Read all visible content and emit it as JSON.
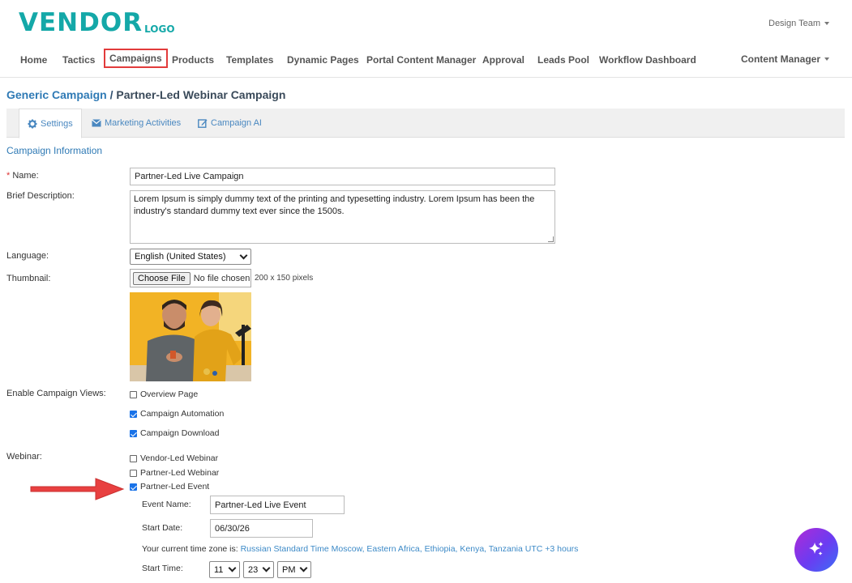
{
  "brand": {
    "name": "VENDOR",
    "sub": "LOGO",
    "color": "#14a8a8"
  },
  "user_menu": {
    "label": "Design Team"
  },
  "nav": {
    "items": [
      "Home",
      "Tactics",
      "Campaigns",
      "Products",
      "Templates",
      "Dynamic Pages",
      "Portal Content Manager",
      "Approval",
      "Leads Pool",
      "Workflow Dashboard"
    ],
    "highlighted": "Campaigns",
    "right": "Content Manager"
  },
  "breadcrumb": {
    "parent": "Generic Campaign",
    "separator": " / ",
    "current": "Partner-Led Webinar Campaign"
  },
  "tabs": [
    {
      "label": "Settings",
      "icon": "gear-icon",
      "active": true
    },
    {
      "label": "Marketing Activities",
      "icon": "envelope-icon",
      "active": false
    },
    {
      "label": "Campaign AI",
      "icon": "edit-icon",
      "active": false
    }
  ],
  "section_title": "Campaign Information",
  "form": {
    "name_required_mark": "*",
    "name_label": " Name:",
    "name_value": "Partner-Led Live Campaign",
    "description_label": "Brief Description:",
    "description_value": "Lorem Ipsum is simply dummy text of the printing and typesetting industry. Lorem Ipsum has been the industry's standard dummy text ever since the 1500s.",
    "language_label": "Language:",
    "language_value": "English (United States)",
    "thumbnail_label": "Thumbnail:",
    "file_button": "Choose File",
    "file_status": "No file chosen",
    "thumbnail_hint": "200 x 150 pixels",
    "views_label": "Enable Campaign Views:",
    "views": [
      {
        "label": "Overview Page",
        "checked": false
      },
      {
        "label": "Campaign Automation",
        "checked": true
      },
      {
        "label": "Campaign Download",
        "checked": true
      }
    ],
    "webinar_label": "Webinar:",
    "webinar_options": [
      {
        "label": "Vendor-Led Webinar",
        "checked": false
      },
      {
        "label": "Partner-Led Webinar",
        "checked": false
      },
      {
        "label": "Partner-Led Event",
        "checked": true
      }
    ],
    "event_name_label": "Event Name:",
    "event_name_value": "Partner-Led Live Event",
    "start_date_label": "Start Date:",
    "start_date_value": "06/30/26",
    "timezone_prefix": "Your current time zone is: ",
    "timezone_value": "Russian Standard Time Moscow, Eastern Africa, Ethiopia, Kenya, Tanzania UTC +3 hours",
    "start_time_label": "Start Time:",
    "start_hour": "11",
    "start_minute": "23",
    "start_ampm": "PM"
  },
  "colors": {
    "link": "#2f7ab5",
    "highlight_border": "#e23b3b",
    "arrow": "#e84040",
    "checkbox": "#1a73e8"
  }
}
